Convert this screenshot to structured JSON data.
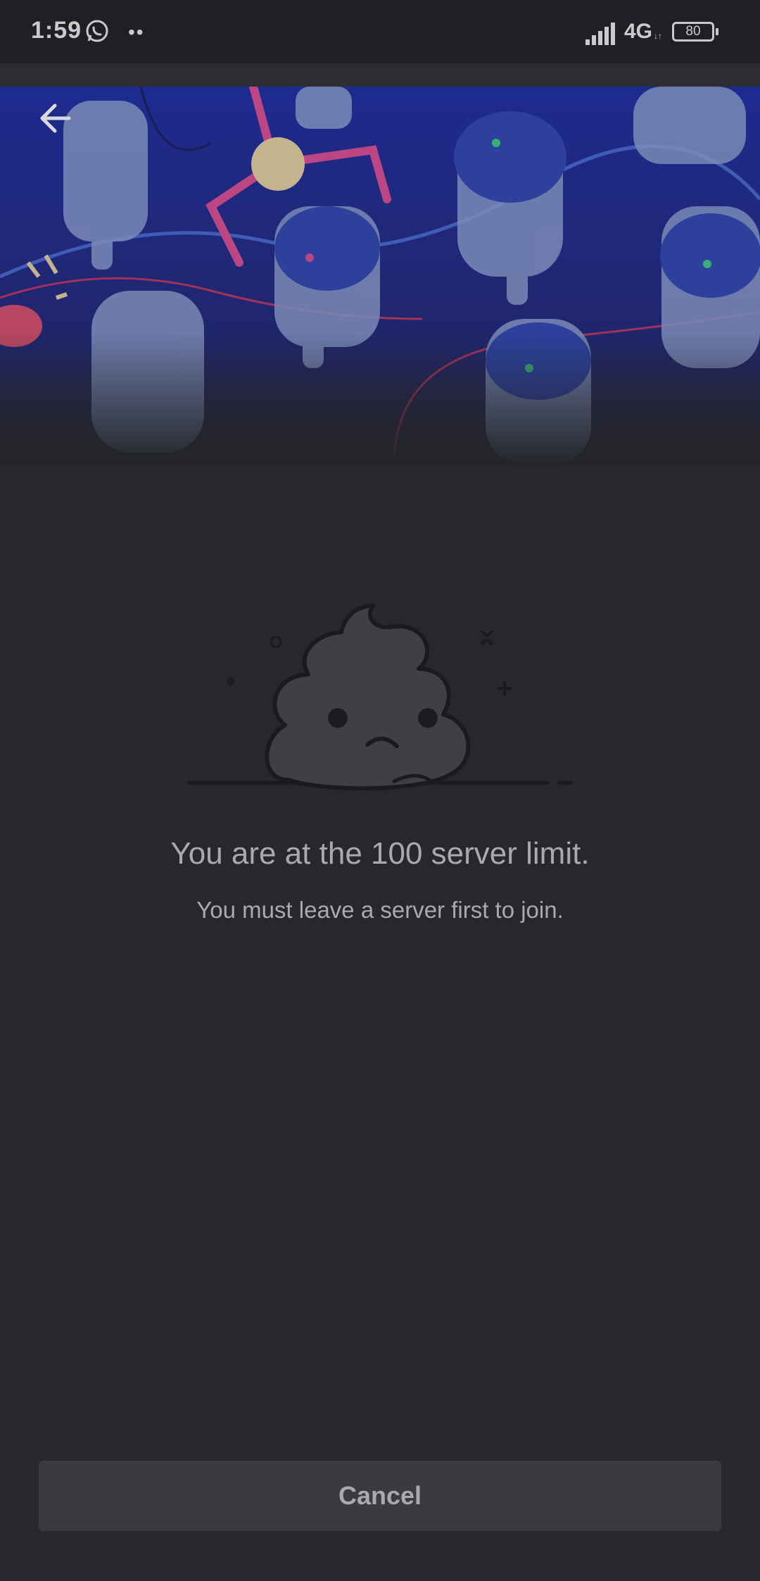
{
  "status_bar": {
    "time": "1:59",
    "dots": "••",
    "network": "4G",
    "network_sub": "↓↑",
    "battery": "80"
  },
  "icons": {
    "whatsapp": "whatsapp-icon",
    "signal": "signal-icon",
    "back": "back-arrow-icon",
    "battery": "battery-icon",
    "illustration": "poop-mascot"
  },
  "content": {
    "title": "You are at the 100 server limit.",
    "subtitle": "You must leave a server first to join."
  },
  "actions": {
    "cancel_label": "Cancel"
  },
  "colors": {
    "background": "#27282c",
    "banner": "#1f2fa8",
    "text": "#a9aaad",
    "button": "#3a3b40"
  }
}
